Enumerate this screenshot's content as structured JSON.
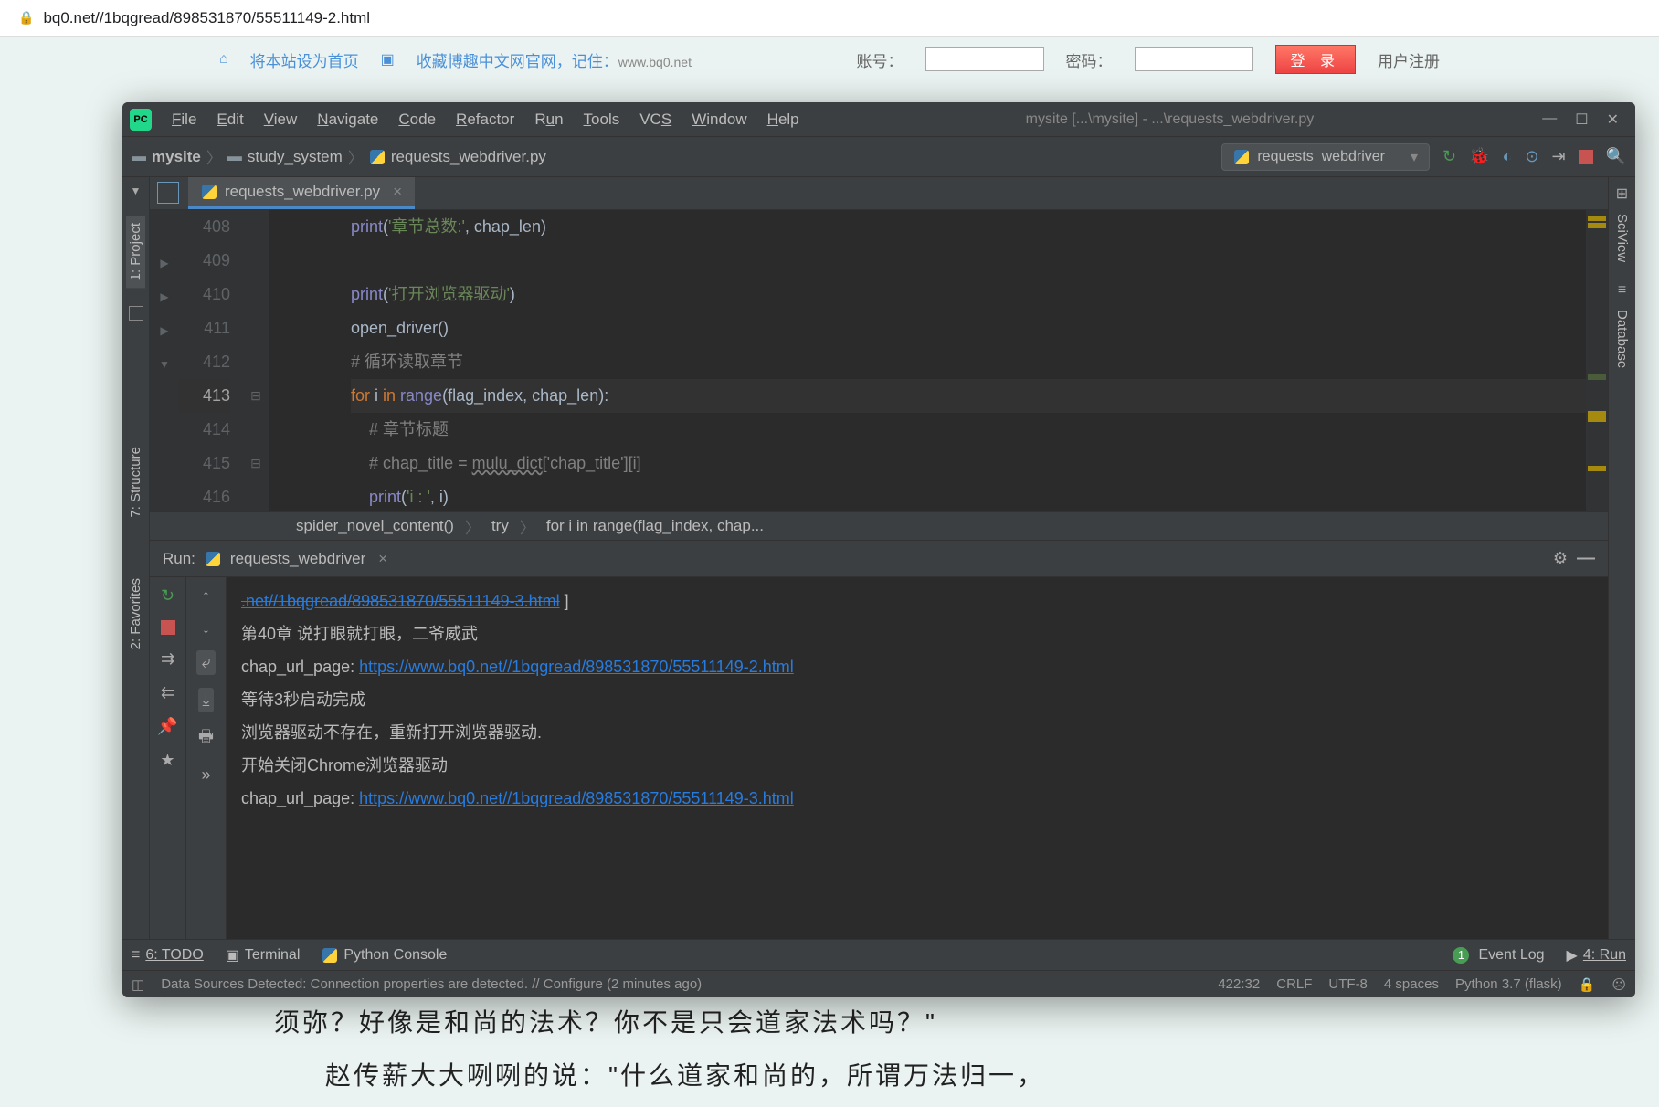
{
  "browser": {
    "url": "bq0.net//1bqgread/898531870/55511149-2.html"
  },
  "site": {
    "set_home": "将本站设为首页",
    "bookmark": "收藏博趣中文网官网，记住：",
    "domain": "www.bq0.net",
    "acct_label": "账号：",
    "pwd_label": "密码：",
    "login_btn": "登 录",
    "register": "用户注册"
  },
  "ide": {
    "menu": [
      "File",
      "Edit",
      "View",
      "Navigate",
      "Code",
      "Refactor",
      "Run",
      "Tools",
      "VCS",
      "Window",
      "Help"
    ],
    "title": "mysite [...\\mysite] - ...\\requests_webdriver.py",
    "breadcrumb": {
      "root": "mysite",
      "pkg": "study_system",
      "file": "requests_webdriver.py"
    },
    "run_config": "requests_webdriver",
    "tab_file": "requests_webdriver.py",
    "left_tabs": {
      "project": "1: Project",
      "structure": "7: Structure",
      "favorites": "2: Favorites"
    },
    "right_tabs": {
      "sciview": "SciView",
      "database": "Database"
    },
    "gutter": [
      "408",
      "409",
      "410",
      "411",
      "412",
      "413",
      "414",
      "415",
      "416"
    ],
    "code": {
      "l408_a": "print",
      "l408_b": "(",
      "l408_c": "'章节总数:'",
      "l408_d": ", chap_len)",
      "l410_a": "print",
      "l410_b": "(",
      "l410_c": "'打开浏览器驱动'",
      "l410_d": ")",
      "l411": "open_driver()",
      "l412": "# 循环读取章节",
      "l413_a": "for ",
      "l413_b": "i ",
      "l413_c": "in ",
      "l413_d": "range",
      "l413_e": "(flag_index, chap_len):",
      "l414": "# 章节标题",
      "l415_a": "# chap_title = ",
      "l415_b": "mulu_dict",
      "l415_c": "['chap_title'][i]",
      "l416_a": "print",
      "l416_b": "(",
      "l416_c": "'i : '",
      "l416_d": ", i)"
    },
    "crumb2": {
      "a": "spider_novel_content()",
      "b": "try",
      "c": "for i in range(flag_index, chap..."
    },
    "run_panel": {
      "label": "Run:",
      "config": "requests_webdriver",
      "lines": {
        "struck": ".net//1bqgread/898531870/55511149-3.html",
        "struck_tail": " ]",
        "l1": "第40章 说打眼就打眼，二爷威武",
        "l2a": "chap_url_page: ",
        "l2b": "https://www.bq0.net//1bqgread/898531870/55511149-2.html",
        "l3": "等待3秒启动完成",
        "l4": "浏览器驱动不存在，重新打开浏览器驱动.",
        "l5": "开始关闭Chrome浏览器驱动",
        "l6a": "chap_url_page: ",
        "l6b": "https://www.bq0.net//1bqgread/898531870/55511149-3.html"
      }
    },
    "bottom_tabs": {
      "todo": "6: TODO",
      "terminal": "Terminal",
      "pyconsole": "Python Console",
      "eventlog": "Event Log",
      "run": "4: Run"
    },
    "status": {
      "msg": "Data Sources Detected: Connection properties are detected. // Configure (2 minutes ago)",
      "pos": "422:32",
      "eol": "CRLF",
      "enc": "UTF-8",
      "indent": "4 spaces",
      "interp": "Python 3.7 (flask)"
    }
  },
  "article": {
    "p1": "须弥？好像是和尚的法术？你不是只会道家法术吗？\"",
    "p2": "赵传薪大大咧咧的说：\"什么道家和尚的，所谓万法归一，"
  }
}
